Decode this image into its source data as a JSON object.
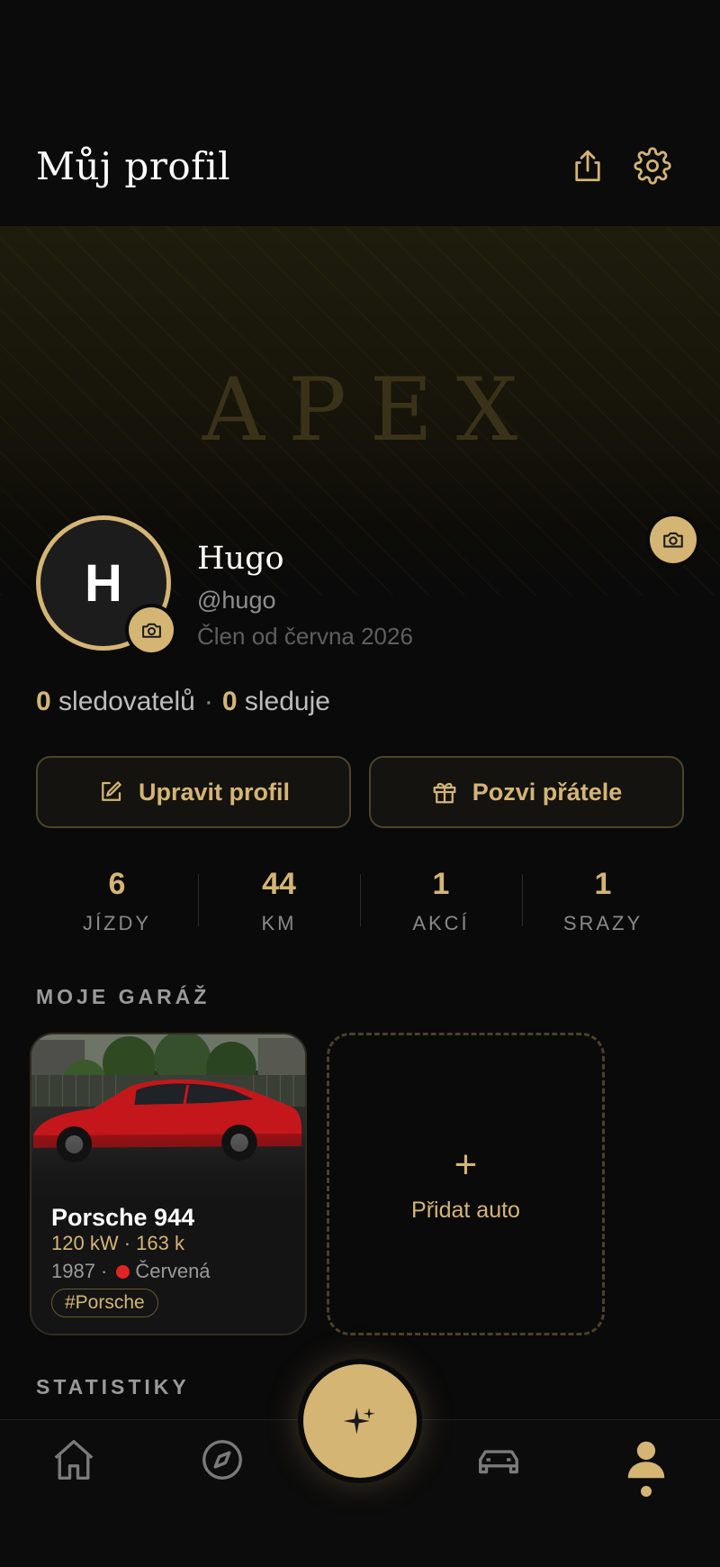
{
  "header": {
    "title": "Můj profil"
  },
  "cover": {
    "logo_text": "APEX"
  },
  "profile": {
    "avatar_initial": "H",
    "name": "Hugo",
    "handle": "@hugo",
    "member_since": "Člen od června 2026",
    "followers_count": "0",
    "followers_label": "sledovatelů",
    "following_count": "0",
    "following_label": "sleduje"
  },
  "actions": {
    "edit_label": "Upravit profil",
    "invite_label": "Pozvi přátele"
  },
  "stats": [
    {
      "value": "6",
      "label": "JÍZDY"
    },
    {
      "value": "44",
      "label": "KM"
    },
    {
      "value": "1",
      "label": "AKCÍ"
    },
    {
      "value": "1",
      "label": "SRAZY"
    }
  ],
  "garage": {
    "title": "MOJE GARÁŽ",
    "cars": [
      {
        "name": "Porsche 944",
        "spec": "120 kW · 163 k",
        "year": "1987 ·",
        "color_name": "Červená",
        "color_hex": "#e02424",
        "tag": "#Porsche"
      }
    ],
    "add_label": "Přidat auto",
    "add_icon": "+"
  },
  "statistics": {
    "title": "STATISTIKY"
  },
  "nav": {
    "items": [
      "home-icon",
      "compass-icon",
      "sparkle-icon",
      "car-icon",
      "profile-icon"
    ],
    "active": "profile-icon"
  },
  "colors": {
    "accent": "#d4b574",
    "background": "#0a0a0a",
    "car_color": "#e02424"
  }
}
